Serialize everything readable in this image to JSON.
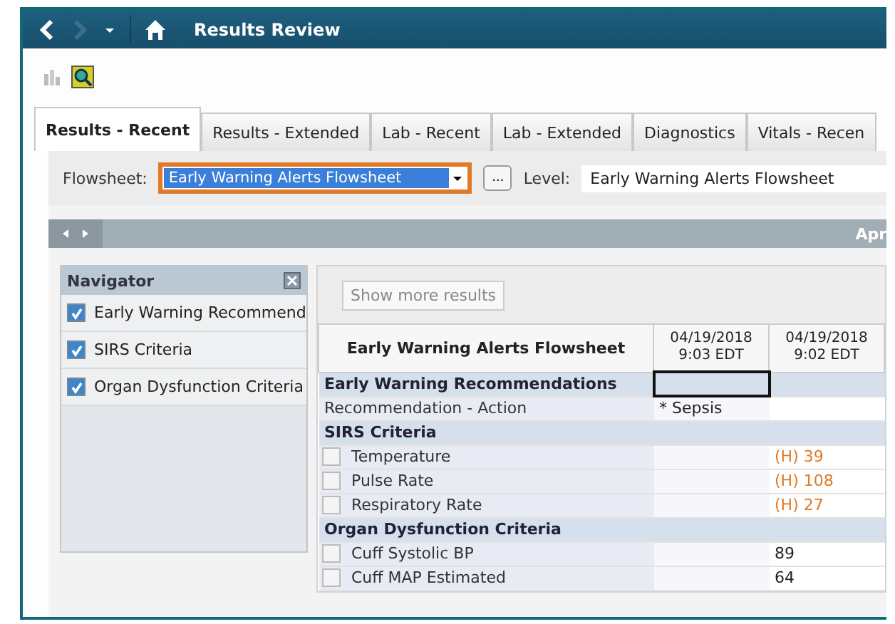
{
  "window": {
    "title": "Results Review"
  },
  "tabs": [
    {
      "label": "Results - Recent",
      "selected": true
    },
    {
      "label": "Results - Extended",
      "selected": false
    },
    {
      "label": "Lab - Recent",
      "selected": false
    },
    {
      "label": "Lab - Extended",
      "selected": false
    },
    {
      "label": "Diagnostics",
      "selected": false
    },
    {
      "label": "Vitals - Recen",
      "selected": false
    }
  ],
  "flowsheet": {
    "label": "Flowsheet:",
    "value": "Early Warning Alerts Flowsheet",
    "highlighted": true,
    "more_button": "...",
    "level_label": "Level:",
    "level_value": "Early Warning Alerts Flowsheet"
  },
  "date_bar": {
    "text": "Apr"
  },
  "navigator": {
    "title": "Navigator",
    "items": [
      {
        "label": "Early Warning Recommend",
        "checked": true
      },
      {
        "label": "SIRS Criteria",
        "checked": true
      },
      {
        "label": "Organ Dysfunction Criteria",
        "checked": true
      }
    ]
  },
  "show_more": "Show more results",
  "table": {
    "title": "Early Warning Alerts Flowsheet",
    "columns": [
      {
        "date": "04/19/2018",
        "time": "9:03 EDT"
      },
      {
        "date": "04/19/2018",
        "time": "9:02 EDT"
      }
    ],
    "rows": [
      {
        "kind": "section",
        "label": "Early Warning Recommendations",
        "cells": [
          {
            "selected": true
          },
          {
            "selected": false
          }
        ]
      },
      {
        "kind": "plain",
        "label": "Recommendation - Action",
        "cells": [
          {
            "value": "* Sepsis",
            "selected": false
          },
          {
            "selected": false
          }
        ]
      },
      {
        "kind": "section",
        "label": "SIRS Criteria",
        "cells": [
          {
            "selected": false
          },
          {
            "selected": false
          }
        ]
      },
      {
        "kind": "check",
        "label": "Temperature",
        "checked": false,
        "cells": [
          {
            "selected": false
          },
          {
            "value": "(H) 39",
            "abnormal": true,
            "selected": false
          }
        ]
      },
      {
        "kind": "check",
        "label": "Pulse Rate",
        "checked": false,
        "cells": [
          {
            "selected": false
          },
          {
            "value": "(H) 108",
            "abnormal": true,
            "selected": false
          }
        ]
      },
      {
        "kind": "check",
        "label": "Respiratory Rate",
        "checked": false,
        "cells": [
          {
            "selected": false
          },
          {
            "value": "(H) 27",
            "abnormal": true,
            "selected": false
          }
        ]
      },
      {
        "kind": "section",
        "label": "Organ Dysfunction Criteria",
        "cells": [
          {
            "selected": false
          },
          {
            "selected": false
          }
        ]
      },
      {
        "kind": "check",
        "label": "Cuff Systolic BP",
        "checked": false,
        "cells": [
          {
            "selected": false
          },
          {
            "value": "89",
            "abnormal": false,
            "selected": false
          }
        ]
      },
      {
        "kind": "check",
        "label": "Cuff MAP Estimated",
        "checked": false,
        "cells": [
          {
            "selected": false
          },
          {
            "value": "64",
            "abnormal": false,
            "selected": false
          }
        ]
      }
    ]
  }
}
